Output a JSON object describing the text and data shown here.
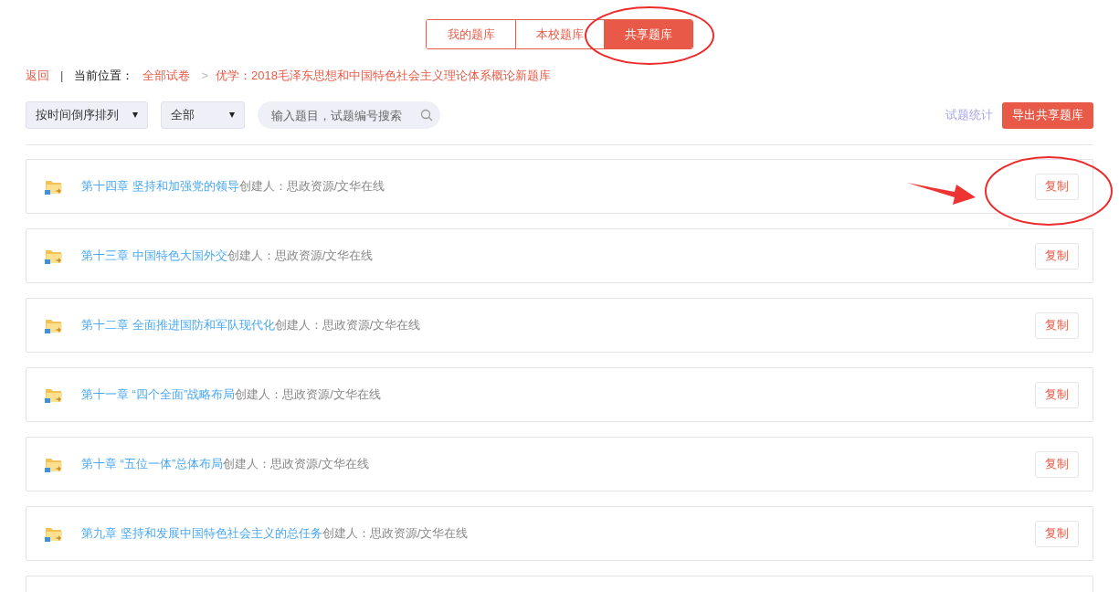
{
  "tabs": [
    {
      "label": "我的题库",
      "selected": false
    },
    {
      "label": "本校题库",
      "selected": false
    },
    {
      "label": "共享题库",
      "selected": true
    }
  ],
  "breadcrumb": {
    "back": "返回",
    "separator": "|",
    "location_label": "当前位置：",
    "root": "全部试卷",
    "arrow": ">",
    "current": "优学：2018毛泽东思想和中国特色社会主义理论体系概论新题库"
  },
  "filters": {
    "sort": "按时间倒序排列",
    "scope": "全部",
    "search": {
      "placeholder": "输入题目，试题编号搜索"
    },
    "stats_link": "试题统计",
    "export_button": "导出共享题库"
  },
  "items": [
    {
      "title": "第十四章 坚持和加强党的领导",
      "creator": "创建人：思政资源/文华在线",
      "button": "复制"
    },
    {
      "title": "第十三章 中国特色大国外交",
      "creator": "创建人：思政资源/文华在线",
      "button": "复制"
    },
    {
      "title": "第十二章 全面推进国防和军队现代化",
      "creator": "创建人：思政资源/文华在线",
      "button": "复制"
    },
    {
      "title": "第十一章 “四个全面”战略布局",
      "creator": "创建人：思政资源/文华在线",
      "button": "复制"
    },
    {
      "title": "第十章 “五位一体”总体布局",
      "creator": "创建人：思政资源/文华在线",
      "button": "复制"
    },
    {
      "title": "第九章  坚持和发展中国特色社会主义的总任务",
      "creator": "创建人：思政资源/文华在线",
      "button": "复制"
    }
  ]
}
